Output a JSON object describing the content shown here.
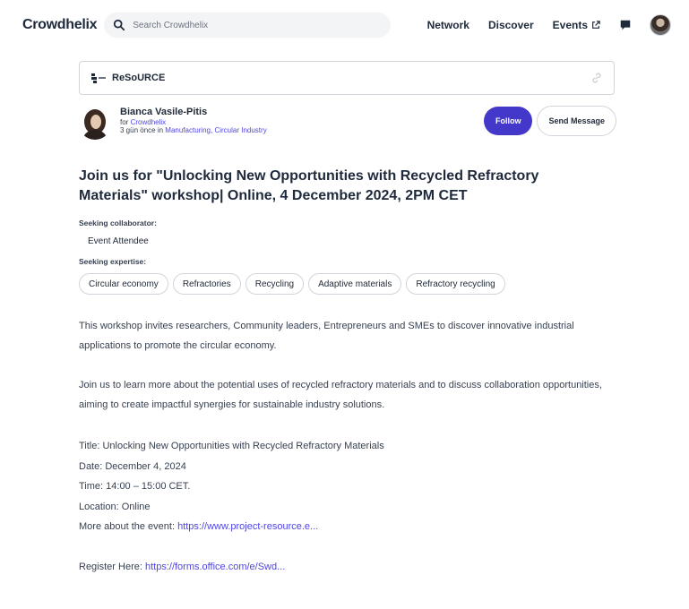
{
  "header": {
    "logo": "Crowdhelix",
    "search_placeholder": "Search Crowdhelix",
    "nav": {
      "network": "Network",
      "discover": "Discover",
      "events": "Events"
    }
  },
  "org": {
    "name": "ReSoURCE"
  },
  "author": {
    "name": "Bianca Vasile-Pitis",
    "for_prefix": "for",
    "for_org": "Crowdhelix",
    "time": "3 gün önce in",
    "category1": "Manufacturing",
    "separator": ",",
    "category2": "Circular Industry"
  },
  "actions": {
    "follow": "Follow",
    "send_message": "Send Message"
  },
  "post": {
    "title": "Join us for \"Unlocking New Opportunities with Recycled Refractory Materials\" workshop| Online, 4 December 2024, 2PM CET",
    "seeking_collaborator_label": "Seeking collaborator:",
    "collaborator": "Event Attendee",
    "seeking_expertise_label": "Seeking expertise:",
    "tags": [
      "Circular economy",
      "Refractories",
      "Recycling",
      "Adaptive materials",
      "Refractory recycling"
    ],
    "para1": "This workshop invites researchers, Community leaders, Entrepreneurs and SMEs to discover innovative industrial applications to promote the circular economy.",
    "para2": "Join us to learn more about the potential uses of recycled refractory materials and to discuss collaboration opportunities, aiming to create impactful synergies for sustainable industry solutions.",
    "details": {
      "title": "Title: Unlocking New Opportunities with Recycled Refractory Materials",
      "date": "Date: December 4, 2024",
      "time": "Time: 14:00 – 15:00 CET.",
      "location": "Location: Online",
      "more_prefix": "More about the event:",
      "more_link": "https://www.project-resource.e...",
      "register_prefix": "Register Here:",
      "register_link": "https://forms.office.com/e/Swd..."
    }
  },
  "colors": {
    "accent": "#4338ca",
    "link": "#4f46e5"
  }
}
